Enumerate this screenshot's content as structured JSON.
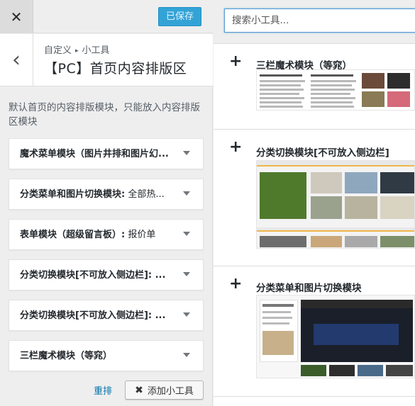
{
  "header": {
    "close_glyph": "✕",
    "save_label": "已保存"
  },
  "section": {
    "back_glyph": "‹",
    "breadcrumb_parent": "自定义",
    "breadcrumb_sep": "▸",
    "breadcrumb_current": "小工具",
    "title": "【PC】首页内容排版区",
    "description": "默认首页的内容排版模块，只能放入内容排版区模块"
  },
  "widgets": [
    {
      "title": "魔术菜单模块（图片井排和图片幻...",
      "subtitle": ""
    },
    {
      "title": "分类菜单和图片切换模块:",
      "subtitle": " 全部热..."
    },
    {
      "title": "表单模块（超级留言板）:",
      "subtitle": " 报价单"
    },
    {
      "title": "分类切换模块[不可放入侧边栏]: ...",
      "subtitle": ""
    },
    {
      "title": "分类切换模块[不可放入侧边栏]: ...",
      "subtitle": ""
    },
    {
      "title": "三栏魔术模块（等窕）",
      "subtitle": ""
    }
  ],
  "footer": {
    "reorder_label": "重排",
    "add_widget_label": "添加小工具",
    "add_glyph": "✖"
  },
  "search": {
    "placeholder": "搜索小工具..."
  },
  "available": [
    {
      "plus": "+",
      "title": "三栏魔术模块（等窕）"
    },
    {
      "plus": "+",
      "title": "分类切换模块[不可放入侧边栏]"
    },
    {
      "plus": "+",
      "title": "分类菜单和图片切换模块"
    }
  ],
  "colors": {
    "accent": "#33a3d6",
    "link": "#0073aa",
    "panel_bg": "#eeeeee"
  }
}
